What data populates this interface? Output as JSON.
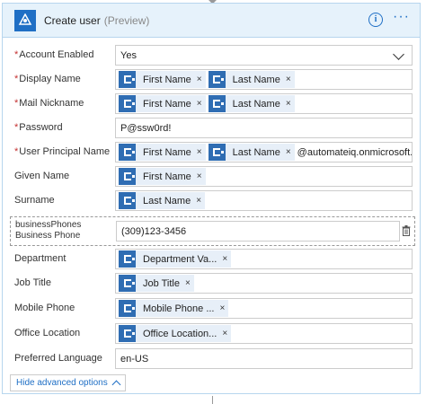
{
  "header": {
    "title": "Create user",
    "badge": "(Preview)"
  },
  "fields": {
    "account_enabled": {
      "label": "Account Enabled",
      "value": "Yes"
    },
    "display_name": {
      "label": "Display Name",
      "tokens": [
        "First Name",
        "Last Name"
      ]
    },
    "mail_nickname": {
      "label": "Mail Nickname",
      "tokens": [
        "First Name",
        "Last Name"
      ]
    },
    "password": {
      "label": "Password",
      "value": "P@ssw0rd!"
    },
    "upn": {
      "label": "User Principal Name",
      "tokens": [
        "First Name",
        "Last Name"
      ],
      "suffix": "@automateiq.onmicrosoft.com"
    },
    "given_name": {
      "label": "Given Name",
      "tokens": [
        "First Name"
      ]
    },
    "surname": {
      "label": "Surname",
      "tokens": [
        "Last Name"
      ]
    },
    "business_phones": {
      "label_line1": "businessPhones",
      "label_line2": "Business Phone",
      "value": "(309)123-3456"
    },
    "department": {
      "label": "Department",
      "tokens": [
        "Department Va..."
      ]
    },
    "job_title": {
      "label": "Job Title",
      "tokens": [
        "Job Title"
      ]
    },
    "mobile_phone": {
      "label": "Mobile Phone",
      "tokens": [
        "Mobile Phone ..."
      ]
    },
    "office_location": {
      "label": "Office Location",
      "tokens": [
        "Office Location..."
      ]
    },
    "preferred_language": {
      "label": "Preferred Language",
      "value": "en-US"
    }
  },
  "required_marker": "*",
  "token_remove": "×",
  "advanced": {
    "label": "Hide advanced options"
  },
  "icons": {
    "app": "azure-ad-icon",
    "info": "info-icon",
    "more": "more-icon",
    "token": "azure-ad-token-icon",
    "trash": "trash-icon",
    "chevron": "chevron-down-icon"
  },
  "colors": {
    "accent": "#1f6fc5",
    "header_bg": "#e6f2fb",
    "token_bg": "#e7eff8",
    "required": "#c43030"
  }
}
